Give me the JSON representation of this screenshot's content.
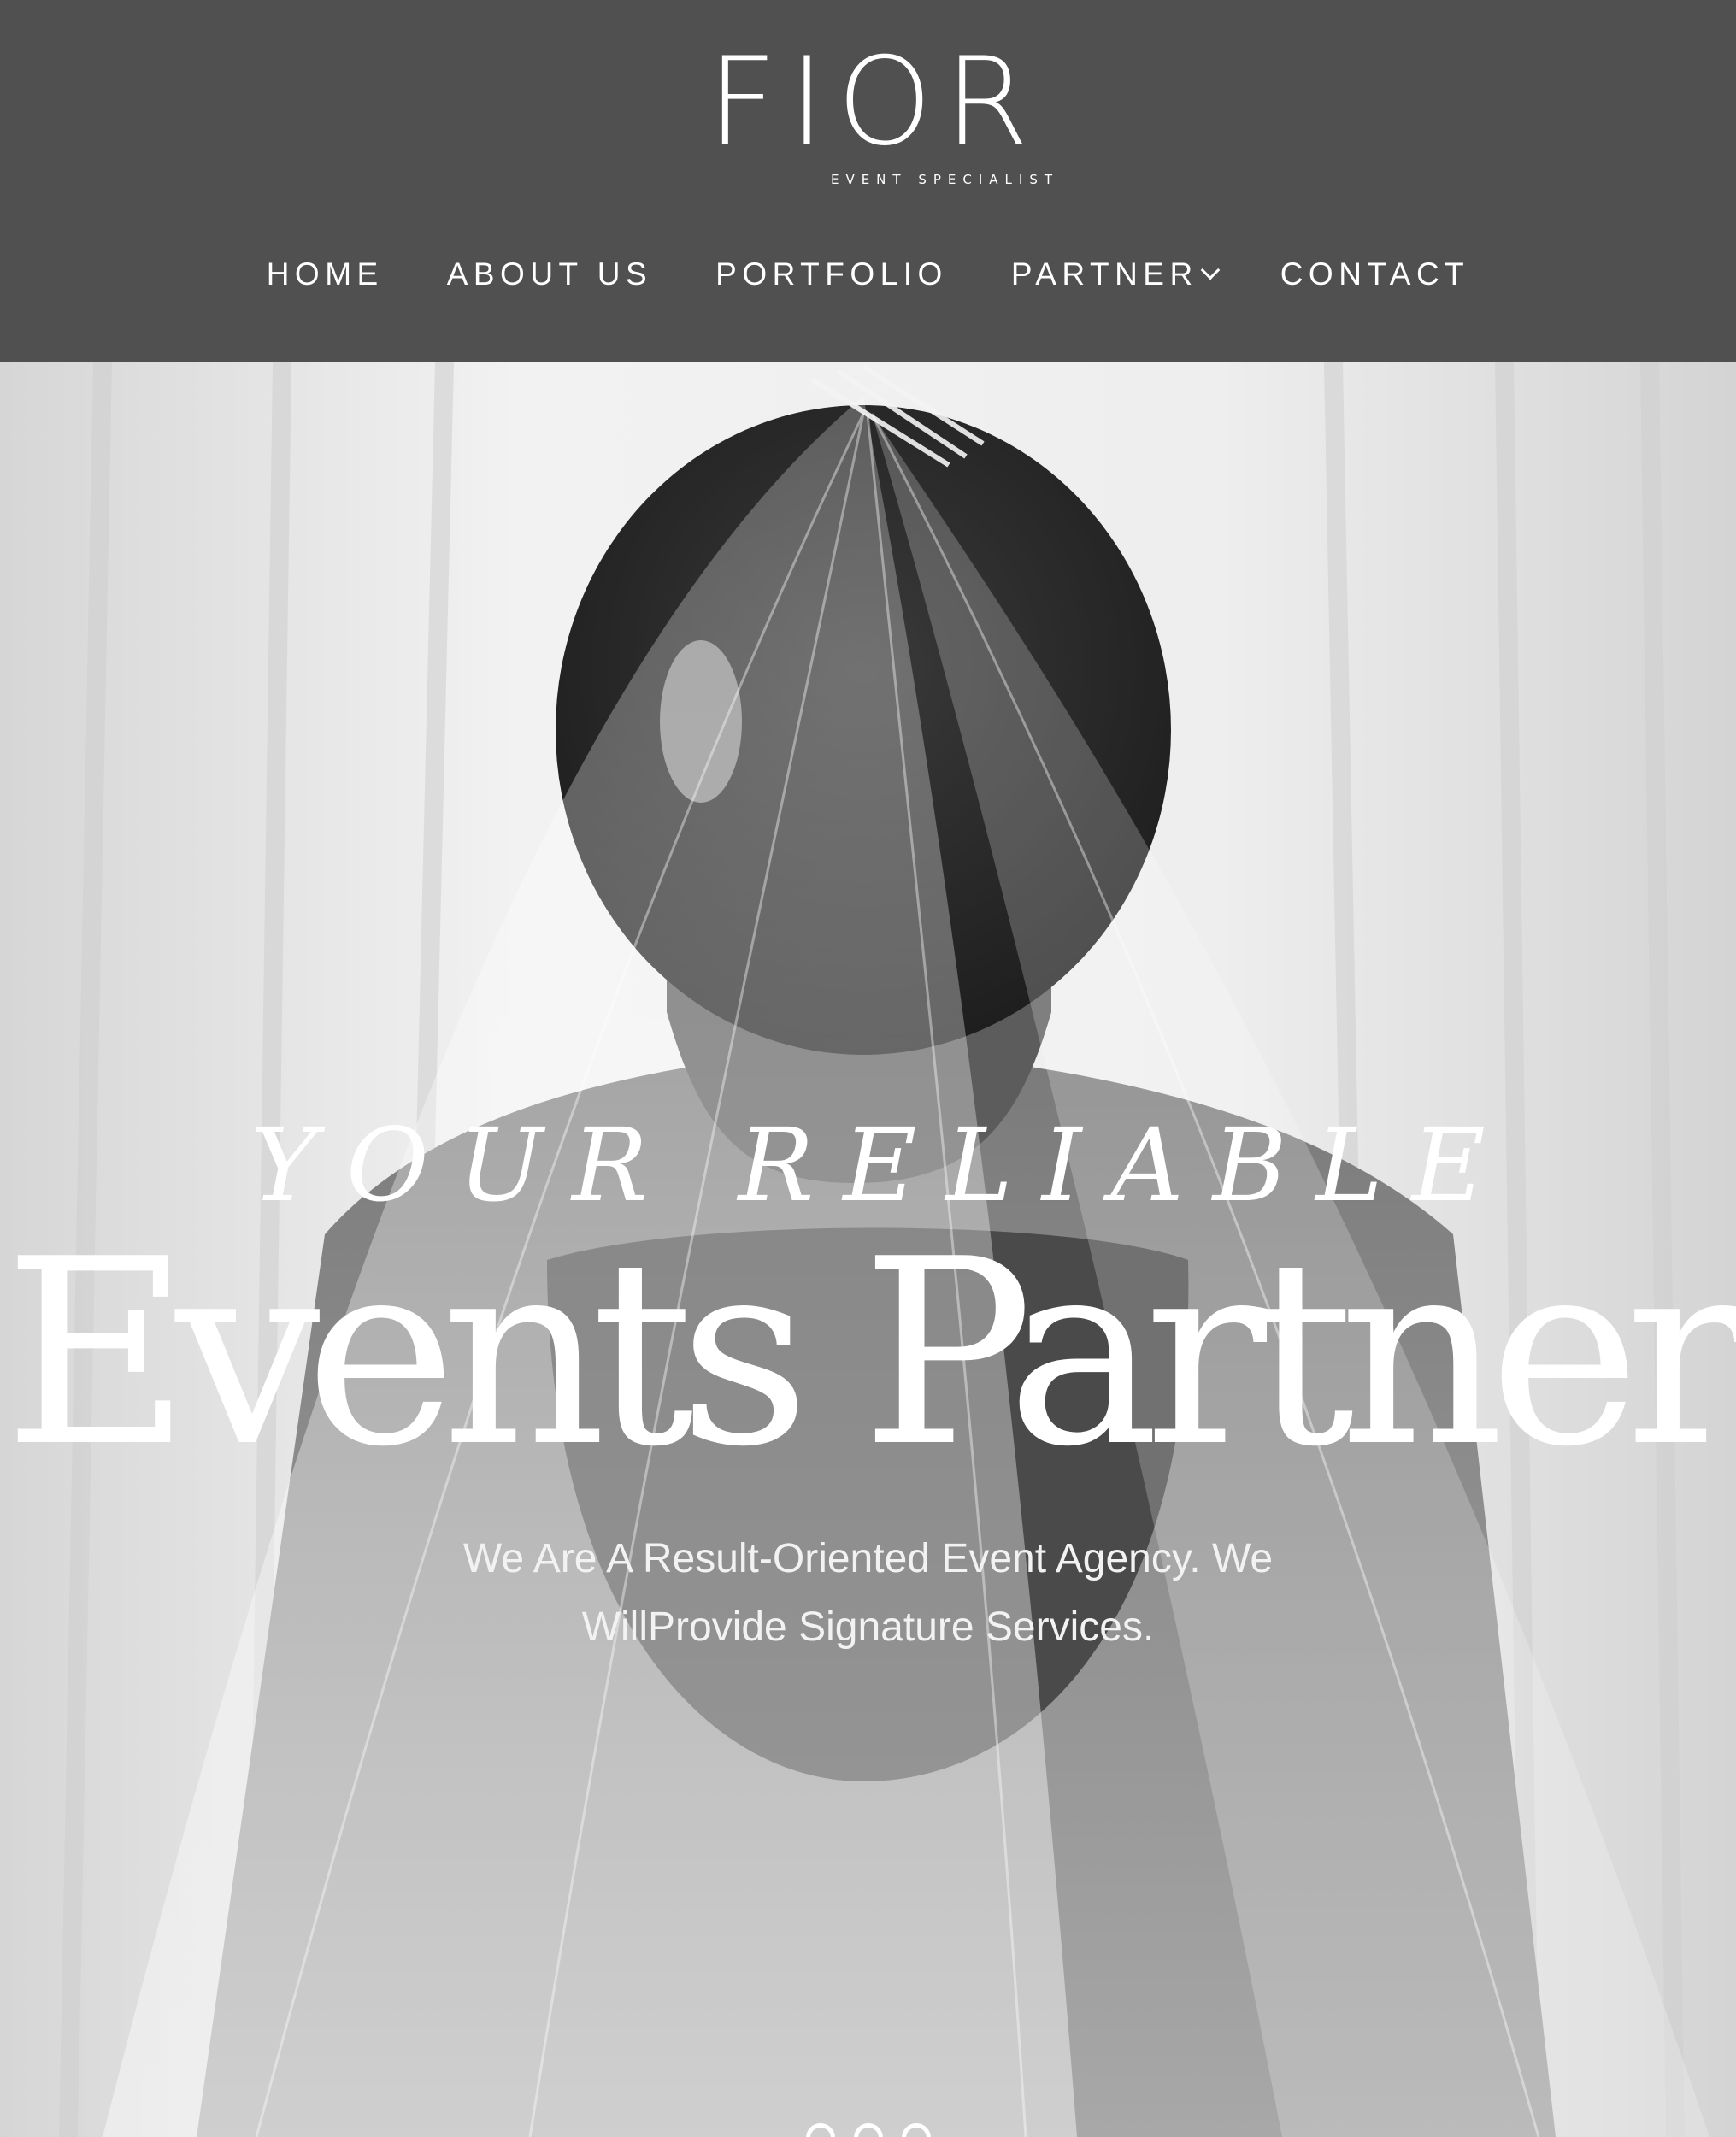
{
  "brand": {
    "name": "FIOR",
    "tagline": "EVENT SPECIALIST"
  },
  "nav": {
    "items": [
      {
        "label": "HOME"
      },
      {
        "label": "ABOUT US"
      },
      {
        "label": "PORTFOLIO"
      },
      {
        "label": "PARTNER",
        "icon": "chevron-down-icon"
      },
      {
        "label": "CONTACT"
      }
    ]
  },
  "hero": {
    "eyebrow": "YOUR RELIABLE",
    "title": "Events Partner",
    "subtitle": "We Are A Result-Oriented Event Agency. We WillProvide Signature Services.",
    "slide_count": 3
  },
  "colors": {
    "header_background": "#505050",
    "text": "#ffffff"
  }
}
